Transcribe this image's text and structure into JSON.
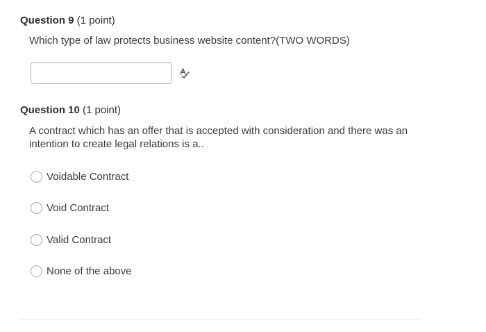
{
  "question9": {
    "number": "Question 9",
    "points": " (1 point)",
    "text": "Which type of law protects business website content?(TWO WORDS)",
    "answer_value": "",
    "answer_placeholder": "",
    "icon": "spell-check-icon"
  },
  "question10": {
    "number": "Question 10",
    "points": " (1 point)",
    "text": "A contract which has an offer that is accepted with consideration and there was an intention to create legal relations is a..",
    "options": [
      {
        "label": "Voidable Contract",
        "selected": false
      },
      {
        "label": "Void Contract",
        "selected": false
      },
      {
        "label": "Valid Contract",
        "selected": false
      },
      {
        "label": "None of the above",
        "selected": false
      }
    ]
  },
  "colors": {
    "text": "#3a3a3a",
    "border": "#b5b5b5",
    "divider": "#e6e6e6"
  }
}
